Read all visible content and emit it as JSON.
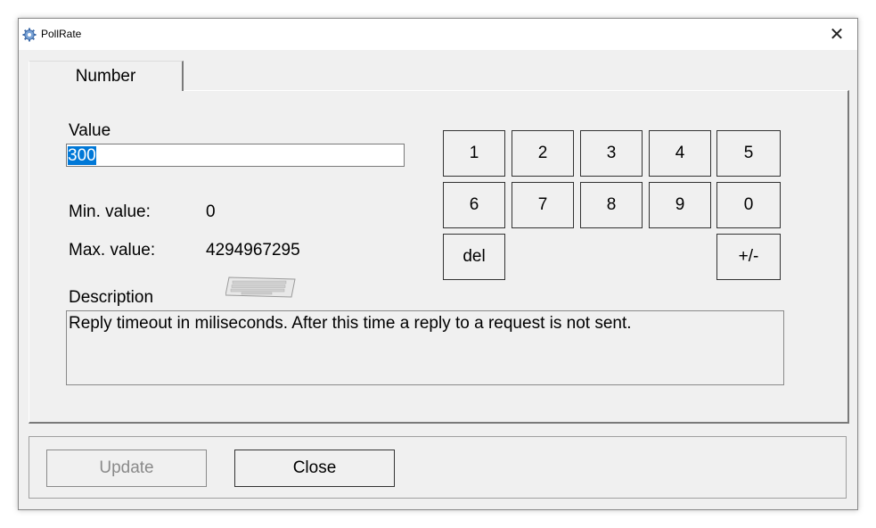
{
  "window": {
    "title": "PollRate",
    "close_glyph": "✕",
    "app_icon": "gear-icon"
  },
  "tabs": [
    {
      "label": "Number",
      "selected": true
    }
  ],
  "form": {
    "value_label": "Value",
    "value": "300",
    "min_label": "Min. value:",
    "min_value": "0",
    "max_label": "Max. value:",
    "max_value": "4294967295",
    "description_label": "Description",
    "description": "Reply timeout in miliseconds. After this time a reply to a request is not sent.",
    "keyboard_icon": "keyboard-icon"
  },
  "keypad": {
    "row1": [
      "1",
      "2",
      "3",
      "4",
      "5"
    ],
    "row2": [
      "6",
      "7",
      "8",
      "9",
      "0"
    ],
    "del": "del",
    "sign": "+/-"
  },
  "buttons": {
    "update": "Update",
    "close": "Close"
  },
  "colors": {
    "selection": "#0078d7",
    "window_bg": "#f0f0f0"
  }
}
